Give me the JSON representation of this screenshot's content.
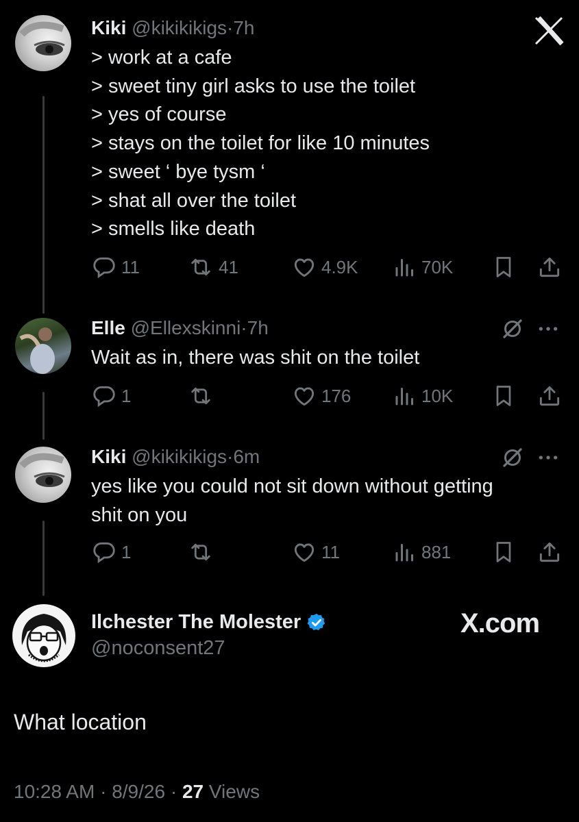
{
  "close_label": "X",
  "watermark": "X.com",
  "tweets": [
    {
      "name": "Kiki",
      "handle": "@kikikikigs",
      "separator": "·",
      "time": "7h",
      "lines": [
        "> work at a cafe",
        "> sweet tiny girl asks to use the toilet",
        "> yes of course",
        "> stays on the toilet for like 10 minutes",
        "> sweet ‘ bye tysm ‘",
        "> shat all over the toilet",
        "> smells like death"
      ],
      "replies": "11",
      "reposts": "41",
      "likes": "4.9K",
      "views": "70K"
    },
    {
      "name": "Elle",
      "handle": "@Ellexskinni",
      "separator": "·",
      "time": "7h",
      "lines": [
        "Wait as in, there was shit on the toilet"
      ],
      "replies": "1",
      "reposts": "",
      "likes": "176",
      "views": "10K"
    },
    {
      "name": "Kiki",
      "handle": "@kikikikigs",
      "separator": "·",
      "time": "6m",
      "lines": [
        "yes like you could not sit down without getting",
        "shit on you"
      ],
      "replies": "1",
      "reposts": "",
      "likes": "11",
      "views": "881"
    }
  ],
  "main_post": {
    "name": "Ilchester The Molester",
    "handle": "@noconsent27",
    "text": "What location",
    "time": "10:28 AM",
    "separator": "·",
    "date": "8/9/26",
    "views_count": "27",
    "views_label": "Views"
  },
  "colors": {
    "background": "#000000",
    "text": "#e7e9ea",
    "muted": "#71767b",
    "verified": "#1d9bf0",
    "thread_line": "#3a3a3a"
  },
  "icons": [
    "reply-icon",
    "repost-icon",
    "like-icon",
    "views-icon",
    "bookmark-icon",
    "share-icon",
    "grok-icon",
    "more-icon",
    "verified-badge-icon"
  ]
}
